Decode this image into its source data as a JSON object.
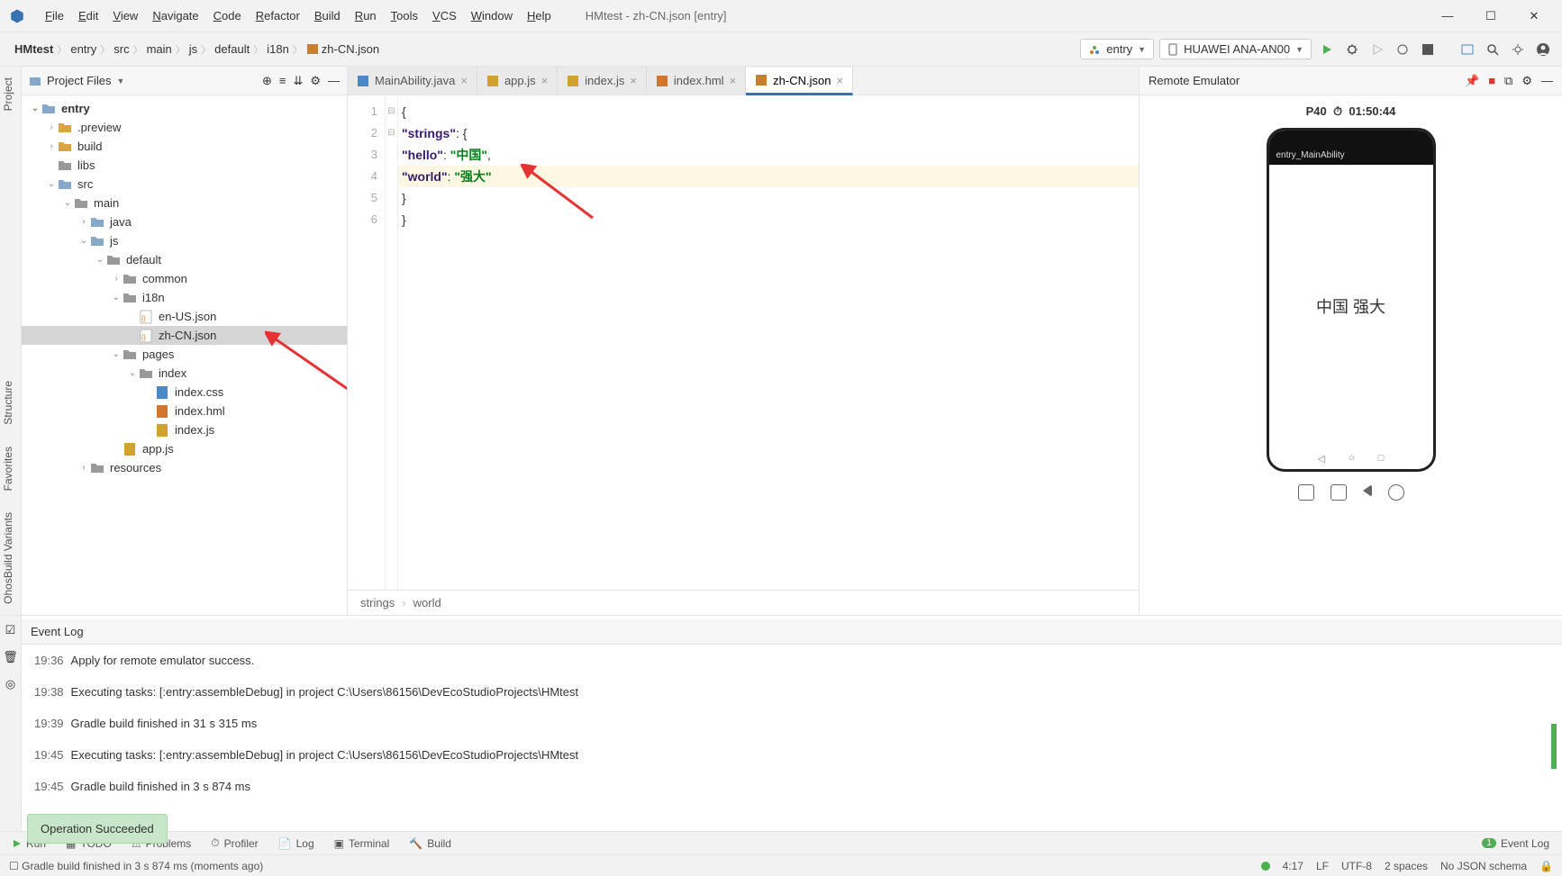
{
  "window_title": "HMtest - zh-CN.json [entry]",
  "menu": [
    "File",
    "Edit",
    "View",
    "Navigate",
    "Code",
    "Refactor",
    "Build",
    "Run",
    "Tools",
    "VCS",
    "Window",
    "Help"
  ],
  "breadcrumbs": [
    "HMtest",
    "entry",
    "src",
    "main",
    "js",
    "default",
    "i18n",
    "zh-CN.json"
  ],
  "config_selector": "entry",
  "device_selector": "HUAWEI ANA-AN00",
  "project_panel_title": "Project Files",
  "project_tree": [
    {
      "indent": 0,
      "arrow": "down",
      "icon": "folder-b",
      "label": "entry",
      "bold": true
    },
    {
      "indent": 1,
      "arrow": "right",
      "icon": "folder-y",
      "label": ".preview"
    },
    {
      "indent": 1,
      "arrow": "right",
      "icon": "folder-y",
      "label": "build"
    },
    {
      "indent": 1,
      "arrow": "none",
      "icon": "folder-g",
      "label": "libs"
    },
    {
      "indent": 1,
      "arrow": "down",
      "icon": "folder-b",
      "label": "src"
    },
    {
      "indent": 2,
      "arrow": "down",
      "icon": "folder-g",
      "label": "main"
    },
    {
      "indent": 3,
      "arrow": "right",
      "icon": "folder-b",
      "label": "java"
    },
    {
      "indent": 3,
      "arrow": "down",
      "icon": "folder-b",
      "label": "js"
    },
    {
      "indent": 4,
      "arrow": "down",
      "icon": "folder-g",
      "label": "default"
    },
    {
      "indent": 5,
      "arrow": "right",
      "icon": "folder-g",
      "label": "common"
    },
    {
      "indent": 5,
      "arrow": "down",
      "icon": "folder-g",
      "label": "i18n"
    },
    {
      "indent": 6,
      "arrow": "none",
      "icon": "file-json",
      "label": "en-US.json"
    },
    {
      "indent": 6,
      "arrow": "none",
      "icon": "file-json",
      "label": "zh-CN.json",
      "selected": true
    },
    {
      "indent": 5,
      "arrow": "down",
      "icon": "folder-g",
      "label": "pages"
    },
    {
      "indent": 6,
      "arrow": "down",
      "icon": "folder-g",
      "label": "index"
    },
    {
      "indent": 7,
      "arrow": "none",
      "icon": "file-css",
      "label": "index.css"
    },
    {
      "indent": 7,
      "arrow": "none",
      "icon": "file-hml",
      "label": "index.hml"
    },
    {
      "indent": 7,
      "arrow": "none",
      "icon": "file-js",
      "label": "index.js"
    },
    {
      "indent": 5,
      "arrow": "none",
      "icon": "file-js",
      "label": "app.js"
    },
    {
      "indent": 3,
      "arrow": "right",
      "icon": "folder-g",
      "label": "resources"
    }
  ],
  "tabs": [
    {
      "label": "MainAbility.java",
      "icon": "java"
    },
    {
      "label": "app.js",
      "icon": "js"
    },
    {
      "label": "index.js",
      "icon": "js"
    },
    {
      "label": "index.hml",
      "icon": "hml"
    },
    {
      "label": "zh-CN.json",
      "icon": "json",
      "active": true
    }
  ],
  "editor_gutter": [
    "1",
    "2",
    "3",
    "4",
    "5",
    "6"
  ],
  "editor_code": {
    "l1_open": "{",
    "l2_key": "\"strings\"",
    "l2_after": ": {",
    "l2_indent": "  ",
    "l3_key": "\"hello\"",
    "l3_after": ": ",
    "l3_val": "\"中国\"",
    "l3_comma": ",",
    "l3_indent": "    ",
    "l4_key": "\"world\"",
    "l4_after": ": ",
    "l4_val": "\"强大\"",
    "l4_indent": "    ",
    "l5_close": "  }",
    "l6_close": "}"
  },
  "editor_breadcrumb": [
    "strings",
    "world"
  ],
  "emulator": {
    "title": "Remote Emulator",
    "device": "P40",
    "timer": "01:50:44",
    "app_title": "entry_MainAbility",
    "screen_text": "中国 强大"
  },
  "event_log_title": "Event Log",
  "event_log": [
    {
      "time": "19:36",
      "msg": "Apply for remote emulator success."
    },
    {
      "time": "19:38",
      "msg": "Executing tasks: [:entry:assembleDebug] in project C:\\Users\\86156\\DevEcoStudioProjects\\HMtest"
    },
    {
      "time": "19:39",
      "msg": "Gradle build finished in 31 s 315 ms"
    },
    {
      "time": "19:45",
      "msg": "Executing tasks: [:entry:assembleDebug] in project C:\\Users\\86156\\DevEcoStudioProjects\\HMtest"
    },
    {
      "time": "19:45",
      "msg": "Gradle build finished in 3 s 874 ms"
    }
  ],
  "toast": "Operation Succeeded",
  "bottom_tools": [
    "Run",
    "TODO",
    "Problems",
    "Profiler",
    "Log",
    "Terminal",
    "Build"
  ],
  "bottom_event_badge": "1",
  "bottom_event_label": "Event Log",
  "statusbar": {
    "msg": "Gradle build finished in 3 s 874 ms (moments ago)",
    "pos": "4:17",
    "eol": "LF",
    "enc": "UTF-8",
    "indent": "2 spaces",
    "schema": "No JSON schema"
  },
  "leftrail_tabs": [
    "Project",
    "Structure",
    "Favorites",
    "OhosBuild Variants"
  ]
}
